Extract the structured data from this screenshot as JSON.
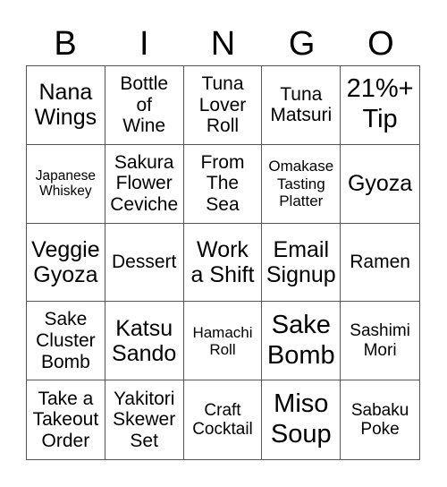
{
  "header": [
    "B",
    "I",
    "N",
    "G",
    "O"
  ],
  "cells": [
    [
      "Nana\nWings",
      "Bottle\nof\nWine",
      "Tuna\nLover\nRoll",
      "Tuna\nMatsuri",
      "21%+\nTip"
    ],
    [
      "Japanese\nWhiskey",
      "Sakura\nFlower\nCeviche",
      "From\nThe\nSea",
      "Omakase\nTasting\nPlatter",
      "Gyoza"
    ],
    [
      "Veggie\nGyoza",
      "Dessert",
      "Work\na Shift",
      "Email\nSignup",
      "Ramen"
    ],
    [
      "Sake\nCluster\nBomb",
      "Katsu\nSando",
      "Hamachi\nRoll",
      "Sake\nBomb",
      "Sashimi\nMori"
    ],
    [
      "Take a\nTakeout\nOrder",
      "Yakitori\nSkewer\nSet",
      "Craft\nCocktail",
      "Miso\nSoup",
      "Sabaku\nPoke"
    ]
  ]
}
